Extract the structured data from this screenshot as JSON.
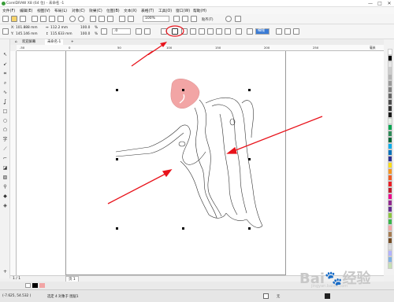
{
  "window": {
    "title": "CorelDRAW X8 (64 位) - 未命名 -1",
    "minimize": "—",
    "maximize": "□",
    "close": "✕"
  },
  "menu": [
    "文件(F)",
    "编辑(E)",
    "视图(V)",
    "布局(L)",
    "对象(C)",
    "效果(C)",
    "位图(B)",
    "文本(X)",
    "表格(T)",
    "工具(O)",
    "窗口(W)",
    "帮助(H)"
  ],
  "standard_toolbar": {
    "zoom_value": "100%",
    "snap_label": "贴齐(T)"
  },
  "property_bar": {
    "x_value": "101.888 mm",
    "y_value": "145.146 mm",
    "width_value": "112.2 mm",
    "height_value": "115.633 mm",
    "scale_x": "100.0",
    "scale_y": "100.0",
    "percent": "%",
    "rotation_value": ".0",
    "outline_width": "细线"
  },
  "doc_tabs": {
    "welcome_tab": "欢迎屏幕",
    "doc_tab": "未命名-1"
  },
  "ruler": {
    "h_ticks": [
      "-50",
      "0",
      "50",
      "100",
      "150",
      "200",
      "250"
    ],
    "unit": "毫米"
  },
  "page_nav": {
    "page_label": "页 1",
    "page_count": "1 / 1"
  },
  "status": {
    "coords": "(-7.625, 54.532 )",
    "object_info": "选定 4 对象于 图层1",
    "fill_label": "无"
  },
  "palette_colors": [
    "#ffffff",
    "#000000",
    "#e6e6e6",
    "#cccccc",
    "#b3b3b3",
    "#999999",
    "#808080",
    "#666666",
    "#4d4d4d",
    "#333333",
    "#1a1a1a",
    "#e6f0e6",
    "#00a651",
    "#2e8b57",
    "#006837",
    "#00aeef",
    "#0072bc",
    "#2e3192",
    "#ffde17",
    "#f7941d",
    "#f15a24",
    "#ed1c24",
    "#be1e2d",
    "#ec008c",
    "#92278f",
    "#662d91",
    "#8dc63f",
    "#39b54a",
    "#f4a6a6",
    "#a67c52",
    "#754c24",
    "#d9d9d9",
    "#b2b2ff",
    "#7fb2e5",
    "#c6e0b4"
  ],
  "annotations": {
    "shape_fill": "#f2a5a5",
    "arrow_color": "#e8131b"
  },
  "watermark": {
    "brand": "Bai",
    "cn": "经验",
    "url": "jingyan.baidu.com"
  }
}
